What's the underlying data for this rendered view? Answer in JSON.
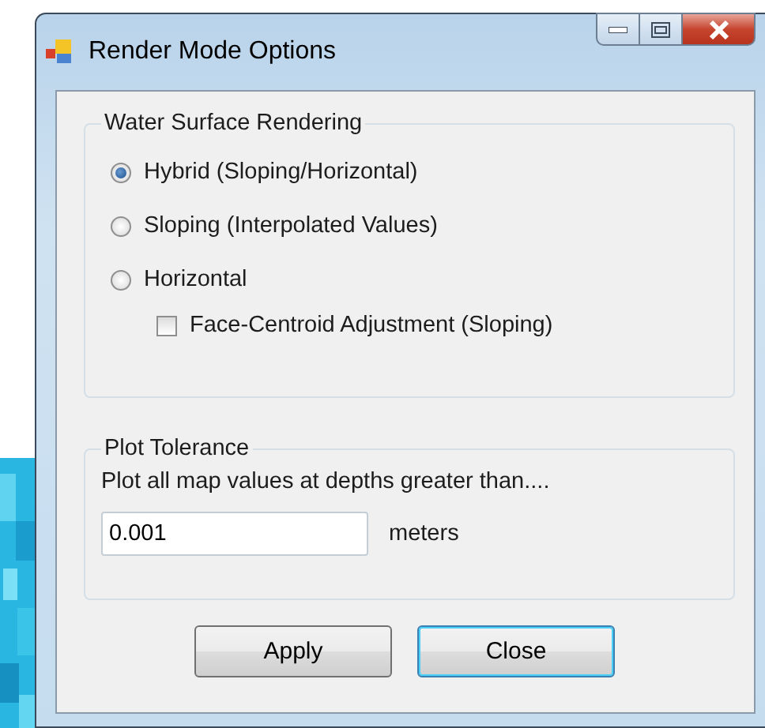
{
  "window": {
    "title": "Render Mode Options"
  },
  "water_surface_rendering": {
    "title": "Water Surface Rendering",
    "options": [
      {
        "label": "Hybrid (Sloping/Horizontal)",
        "selected": true
      },
      {
        "label": "Sloping (Interpolated Values)",
        "selected": false
      },
      {
        "label": "Horizontal",
        "selected": false
      }
    ],
    "face_centroid": {
      "label": "Face-Centroid Adjustment (Sloping)",
      "checked": false
    }
  },
  "plot_tolerance": {
    "title": "Plot Tolerance",
    "description": "Plot all map values at depths greater than....",
    "value": "0.001",
    "unit": "meters"
  },
  "buttons": [
    {
      "label": "Apply",
      "focused": false
    },
    {
      "label": "Close",
      "focused": true
    }
  ]
}
